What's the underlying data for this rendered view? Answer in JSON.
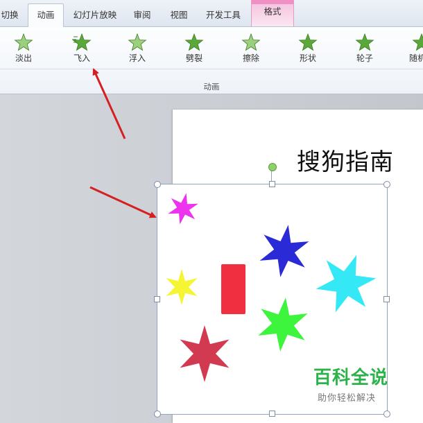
{
  "window": {
    "title_fragment": ""
  },
  "tabs": [
    {
      "label": "切换"
    },
    {
      "label": "动画",
      "active": true
    },
    {
      "label": "幻灯片放映"
    },
    {
      "label": "审阅"
    },
    {
      "label": "视图"
    },
    {
      "label": "开发工具"
    },
    {
      "label": "格式",
      "contextual": true
    }
  ],
  "ribbon": {
    "group_label": "动画",
    "effects": [
      {
        "label": "淡出",
        "icon": "fade-star-icon"
      },
      {
        "label": "飞入",
        "icon": "fly-in-star-icon"
      },
      {
        "label": "浮入",
        "icon": "float-in-star-icon"
      },
      {
        "label": "劈裂",
        "icon": "split-star-icon"
      },
      {
        "label": "擦除",
        "icon": "wipe-star-icon"
      },
      {
        "label": "形状",
        "icon": "shape-star-icon"
      },
      {
        "label": "轮子",
        "icon": "wheel-star-icon"
      },
      {
        "label": "随机线",
        "icon": "random-bars-star-icon"
      }
    ]
  },
  "slide": {
    "title": "搜狗指南",
    "picture_stars": [
      {
        "color": "#ee33ee",
        "shape": "six-point-star"
      },
      {
        "color": "#2a2ad6",
        "shape": "six-point-star"
      },
      {
        "color": "#f5f533",
        "shape": "six-point-star"
      },
      {
        "color": "#35e8f5",
        "shape": "six-point-star"
      },
      {
        "color": "#3cf53c",
        "shape": "six-point-star"
      },
      {
        "color": "#d23a52",
        "shape": "six-point-star"
      }
    ],
    "picture_rect_color": "#f03040"
  },
  "watermark": {
    "title": "百科全说",
    "subtitle": "助你轻松解决"
  },
  "colors": {
    "accent_arrow": "#d42020",
    "ribbon_star": "#5aa83a",
    "contextual_tab": "#f08fc3"
  }
}
